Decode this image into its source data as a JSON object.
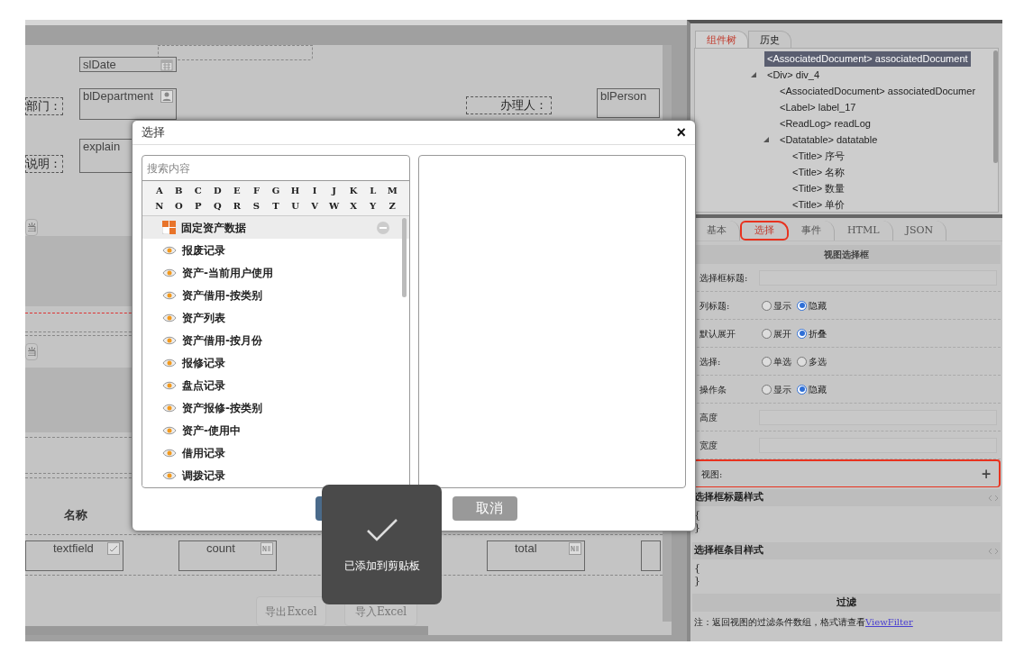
{
  "canvas": {
    "labels": [
      "部门：",
      "说明：",
      "办理人："
    ],
    "fields": [
      {
        "kind": "date",
        "value": "slDate"
      },
      {
        "kind": "person",
        "value": "blDepartment"
      },
      {
        "kind": "plain",
        "value": "explain"
      },
      {
        "kind": "plain",
        "value": "blPerson"
      },
      {
        "kind": "text",
        "value": "textfield"
      },
      {
        "kind": "number",
        "value": "count"
      },
      {
        "kind": "number",
        "value": "total"
      }
    ],
    "side_buttons": [
      "当",
      "当"
    ],
    "column_header": "名称",
    "buttons": [
      "导出Excel",
      "导入Excel"
    ]
  },
  "dialog": {
    "title": "选择",
    "close": "×",
    "search": {
      "placeholder": "搜索内容"
    },
    "letters": [
      "A",
      "B",
      "C",
      "D",
      "E",
      "F",
      "G",
      "H",
      "I",
      "J",
      "K",
      "L",
      "M",
      "N",
      "O",
      "P",
      "Q",
      "R",
      "S",
      "T",
      "U",
      "V",
      "W",
      "X",
      "Y",
      "Z"
    ],
    "items": [
      {
        "kind": "group",
        "label": "固定资产数据",
        "selected": true
      },
      {
        "kind": "view",
        "label": "报废记录",
        "selected": false
      },
      {
        "kind": "view",
        "label": "资产-当前用户使用",
        "selected": false
      },
      {
        "kind": "view",
        "label": "资产借用-按类别",
        "selected": false
      },
      {
        "kind": "view",
        "label": "资产列表",
        "selected": false
      },
      {
        "kind": "view",
        "label": "资产借用-按月份",
        "selected": false
      },
      {
        "kind": "view",
        "label": "报修记录",
        "selected": false
      },
      {
        "kind": "view",
        "label": "盘点记录",
        "selected": false
      },
      {
        "kind": "view",
        "label": "资产报修-按类别",
        "selected": false
      },
      {
        "kind": "view",
        "label": "资产-使用中",
        "selected": false
      },
      {
        "kind": "view",
        "label": "借用记录",
        "selected": false
      },
      {
        "kind": "view",
        "label": "调拨记录",
        "selected": false
      }
    ],
    "buttons": [
      {
        "kind": "primary"
      },
      {
        "kind": "secondary",
        "label": "取消"
      }
    ]
  },
  "toast": {
    "message": "已添加到剪贴板"
  },
  "panel": {
    "tabs": [
      {
        "label": "组件树",
        "selected": true
      },
      {
        "label": "历史",
        "selected": false
      }
    ],
    "tree": [
      {
        "label": "<AssociatedDocument> associatedDocument",
        "selected": true
      },
      {
        "label": "<Div> div_4",
        "selected": false,
        "expanded": true,
        "children": [
          {
            "label": "<AssociatedDocument> associatedDocumer",
            "selected": false
          },
          {
            "label": "<Label> label_17",
            "selected": false
          },
          {
            "label": "<ReadLog> readLog",
            "selected": false
          },
          {
            "label": "<Datatable> datatable",
            "selected": false,
            "expanded": true,
            "children": [
              {
                "label": "<Title> 序号",
                "selected": false
              },
              {
                "label": "<Title> 名称",
                "selected": false
              },
              {
                "label": "<Title> 数量",
                "selected": false
              },
              {
                "label": "<Title> 单价",
                "selected": false
              }
            ]
          }
        ]
      }
    ],
    "property_tabs": [
      {
        "label": "基本",
        "selected": false,
        "highlighted": false
      },
      {
        "label": "选择",
        "selected": true,
        "highlighted": true
      },
      {
        "label": "事件",
        "selected": false,
        "highlighted": false
      },
      {
        "label": "HTML",
        "selected": false,
        "highlighted": false
      },
      {
        "label": "JSON",
        "selected": false,
        "highlighted": false
      }
    ],
    "section_title": "视图选择框",
    "rows": [
      {
        "kind": "field",
        "label": "选择框标题:",
        "highlighted": false
      },
      {
        "kind": "radio",
        "label": "列标题:",
        "highlighted": false,
        "options": [
          {
            "label": "显示",
            "selected": false
          },
          {
            "label": "隐藏",
            "selected": true
          }
        ]
      },
      {
        "kind": "radio",
        "label": "默认展开",
        "highlighted": false,
        "options": [
          {
            "label": "展开",
            "selected": false
          },
          {
            "label": "折叠",
            "selected": true
          }
        ]
      },
      {
        "kind": "radio",
        "label": "选择:",
        "highlighted": false,
        "options": [
          {
            "label": "单选",
            "selected": false
          },
          {
            "label": "多选",
            "selected": false
          }
        ]
      },
      {
        "kind": "radio",
        "label": "操作条",
        "highlighted": false,
        "options": [
          {
            "label": "显示",
            "selected": false
          },
          {
            "label": "隐藏",
            "selected": true
          }
        ]
      },
      {
        "kind": "field",
        "label": "高度",
        "highlighted": false
      },
      {
        "kind": "field",
        "label": "宽度",
        "highlighted": false
      },
      {
        "kind": "add",
        "label": "视图:",
        "action": "+",
        "highlighted": true
      }
    ],
    "styles": [
      {
        "title": "选择框标题样式",
        "lines": [
          "{",
          "}"
        ]
      },
      {
        "title": "选择框条目样式",
        "lines": [
          "{",
          "}"
        ]
      }
    ],
    "filter": {
      "title": "过滤",
      "note": "注：返回视图的过滤条件数组，格式请查看",
      "link": "ViewFilter"
    }
  }
}
